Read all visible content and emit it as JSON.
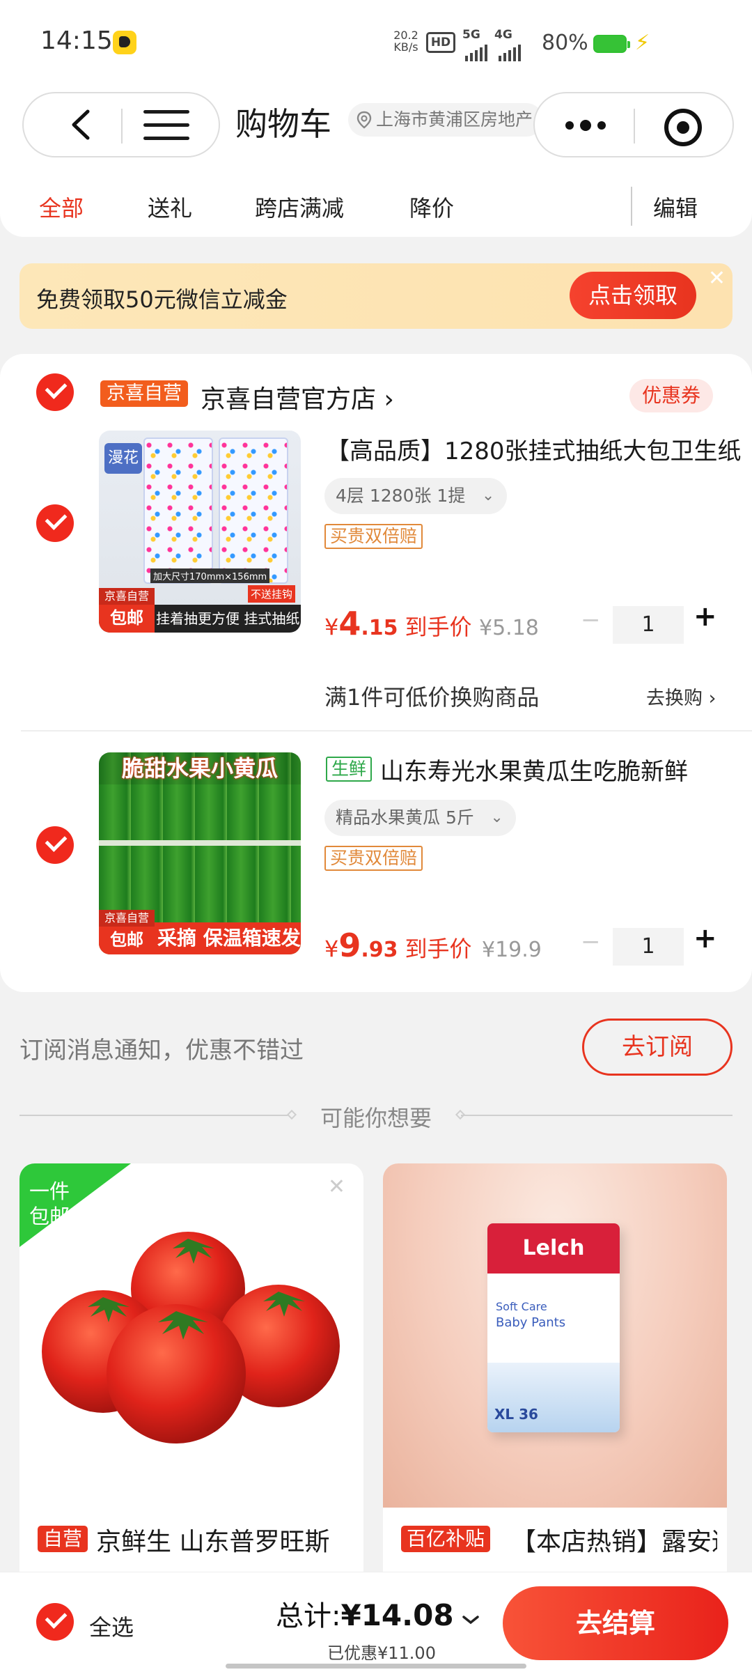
{
  "status_bar": {
    "time": "14:15",
    "net_speed_value": "20.2",
    "net_speed_unit": "KB/s",
    "hd": "HD",
    "sig1": "5G",
    "sig2": "4G",
    "battery": "80%"
  },
  "header": {
    "title": "购物车",
    "location": "上海市黄浦区房地产"
  },
  "tabs": [
    {
      "label": "全部",
      "active": true
    },
    {
      "label": "送礼"
    },
    {
      "label": "跨店满减"
    },
    {
      "label": "降价"
    },
    {
      "label": "编辑"
    }
  ],
  "promo": {
    "text": "免费领取50元微信立减金",
    "button": "点击领取",
    "close": "✕"
  },
  "store": {
    "badge": "京喜自营",
    "name": "京喜自营官方店 ›",
    "coupon": "优惠券"
  },
  "items": [
    {
      "title": "【高品质】1280张挂式抽纸大包卫生纸",
      "spec": "4层 1280张 1提",
      "guarantee": "买贵双倍赔",
      "price_symbol": "¥",
      "price_int": "4",
      "price_dec": ".15",
      "price_label": "到手价",
      "orig_price": "¥5.18",
      "qty": "1",
      "img_brand": "漫花",
      "img_caption": "挂着抽更方便 挂式抽纸",
      "img_tag1": "京喜自营",
      "img_tag2": "包邮",
      "img_size": "加大尺寸170mm×156mm",
      "img_hook": "不送挂钩"
    },
    {
      "fresh_tag": "生鲜",
      "title": "山东寿光水果黄瓜生吃脆新鲜",
      "spec": "精品水果黄瓜 5斤",
      "guarantee": "买贵双倍赔",
      "price_symbol": "¥",
      "price_int": "9",
      "price_dec": ".93",
      "price_label": "到手价",
      "orig_price": "¥19.9",
      "qty": "1",
      "img_headline": "脆甜水果小黄瓜",
      "img_caption": "采摘 保温箱速发",
      "img_tag1": "京喜自营",
      "img_tag2": "包邮"
    }
  ],
  "swap": {
    "text": "满1件可低价换购商品",
    "link": "去换购 ›"
  },
  "subscribe": {
    "text": "订阅消息通知，优惠不错过",
    "button": "去订阅"
  },
  "recommend": {
    "title": "可能你想要",
    "cards": [
      {
        "badge": "自营",
        "title": "京鲜生 山东普罗旺斯",
        "corner": "一件包邮",
        "close": "✕"
      },
      {
        "badge": "百亿补贴",
        "title": "【本店热销】露安适",
        "brand": "Lelch",
        "sub1": "Soft Care",
        "sub2": "Baby Pants",
        "size": "XL 36"
      }
    ]
  },
  "bottom": {
    "select_all": "全选",
    "total_label": "总计:",
    "total_value": "¥14.08",
    "discount": "已优惠¥11.00",
    "checkout": "去结算"
  },
  "colors": {
    "accent": "#e8341f",
    "self_badge": "#f25d1d",
    "fresh": "#2ea84a"
  }
}
